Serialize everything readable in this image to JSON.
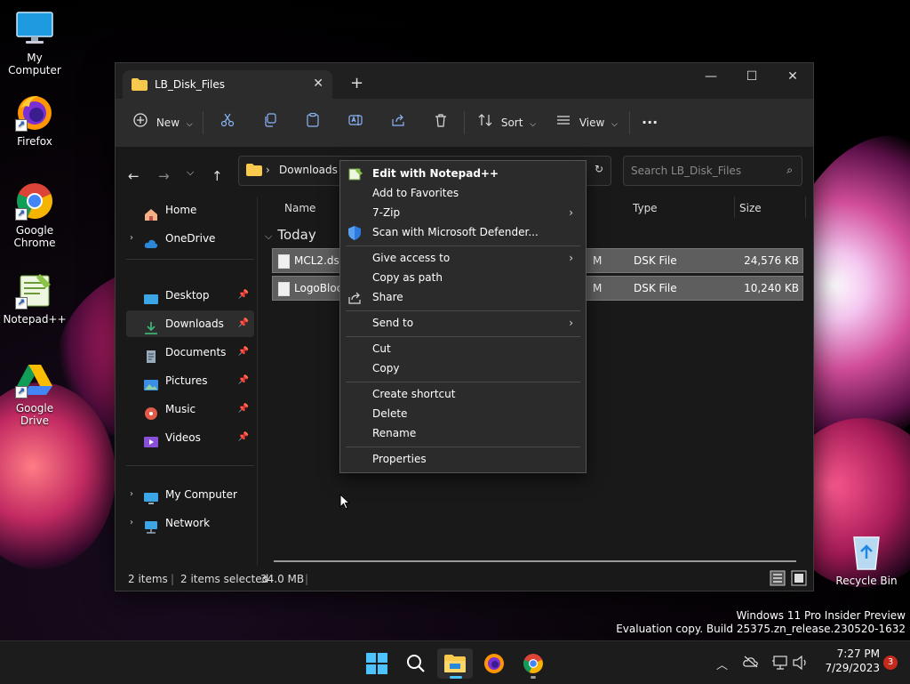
{
  "desktop": {
    "icons": [
      {
        "label": "My Computer"
      },
      {
        "label": "Firefox"
      },
      {
        "label": "Google Chrome"
      },
      {
        "label": "Notepad++"
      },
      {
        "label": "Google Drive"
      },
      {
        "label": "Recycle Bin"
      }
    ],
    "watermark": {
      "line1": "Windows 11 Pro Insider Preview",
      "line2": "Evaluation copy. Build 25375.zn_release.230520-1632"
    }
  },
  "explorer": {
    "tab_title": "LB_Disk_Files",
    "toolbar": {
      "new_label": "New",
      "sort_label": "Sort",
      "view_label": "View"
    },
    "breadcrumb": [
      "Downloads"
    ],
    "search_placeholder": "Search LB_Disk_Files",
    "nav": {
      "home": "Home",
      "onedrive": "OneDrive",
      "quick": [
        {
          "label": "Desktop"
        },
        {
          "label": "Downloads"
        },
        {
          "label": "Documents"
        },
        {
          "label": "Pictures"
        },
        {
          "label": "Music"
        },
        {
          "label": "Videos"
        }
      ],
      "my_computer": "My Computer",
      "network": "Network"
    },
    "columns": {
      "name": "Name",
      "type": "Type",
      "size": "Size"
    },
    "group_label": "Today",
    "files": [
      {
        "name": "MCL2.dsk",
        "date_tail": "M",
        "type": "DSK File",
        "size": "24,576 KB"
      },
      {
        "name": "LogoBlock",
        "date_tail": "M",
        "type": "DSK File",
        "size": "10,240 KB"
      }
    ],
    "status": {
      "items": "2 items",
      "selected": "2 items selected",
      "size": "34.0 MB"
    }
  },
  "context_menu": {
    "edit_notepad": "Edit with Notepad++",
    "add_favorites": "Add to Favorites",
    "seven_zip": "7-Zip",
    "scan_defender": "Scan with Microsoft Defender...",
    "give_access": "Give access to",
    "copy_path": "Copy as path",
    "share": "Share",
    "send_to": "Send to",
    "cut": "Cut",
    "copy": "Copy",
    "create_shortcut": "Create shortcut",
    "delete": "Delete",
    "rename": "Rename",
    "properties": "Properties"
  },
  "taskbar": {
    "time": "7:27 PM",
    "date": "7/29/2023",
    "notification_count": "3"
  }
}
